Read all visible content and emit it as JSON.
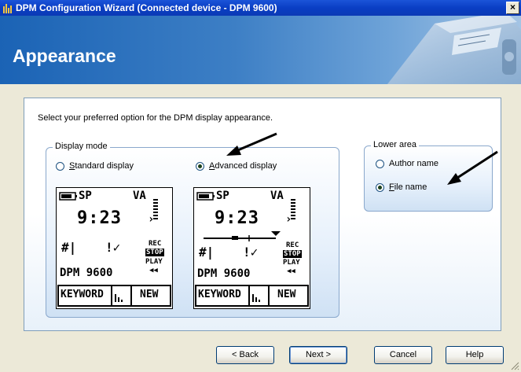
{
  "window": {
    "title": "DPM Configuration Wizard (Connected device - DPM 9600)",
    "close_label": "×"
  },
  "header": {
    "heading": "Appearance"
  },
  "content": {
    "intro": "Select your preferred option for the DPM display appearance."
  },
  "display_mode": {
    "group_label": "Display mode",
    "options": [
      {
        "label": "Standard display",
        "checked": false
      },
      {
        "label": "Advanced display",
        "checked": true
      }
    ]
  },
  "lower_area": {
    "group_label": "Lower area",
    "options": [
      {
        "label": "Author name",
        "checked": false
      },
      {
        "label": "File name",
        "checked": true
      }
    ]
  },
  "lcd": {
    "mode": "SP",
    "va": "VA",
    "time": "9:23",
    "hash": "#|",
    "check": "!✓",
    "rec": "REC",
    "stop": "STOP",
    "play": "PLAY",
    "rewind": "◀◀",
    "model": "DPM 9600",
    "keyword": "KEYWORD",
    "new": "NEW"
  },
  "buttons": {
    "back": "< Back",
    "next": "Next >",
    "cancel": "Cancel",
    "help": "Help"
  },
  "colors": {
    "titlebar": "#0a3ec4",
    "header_start": "#1b63b5",
    "frame_border": "#7f9db9"
  }
}
